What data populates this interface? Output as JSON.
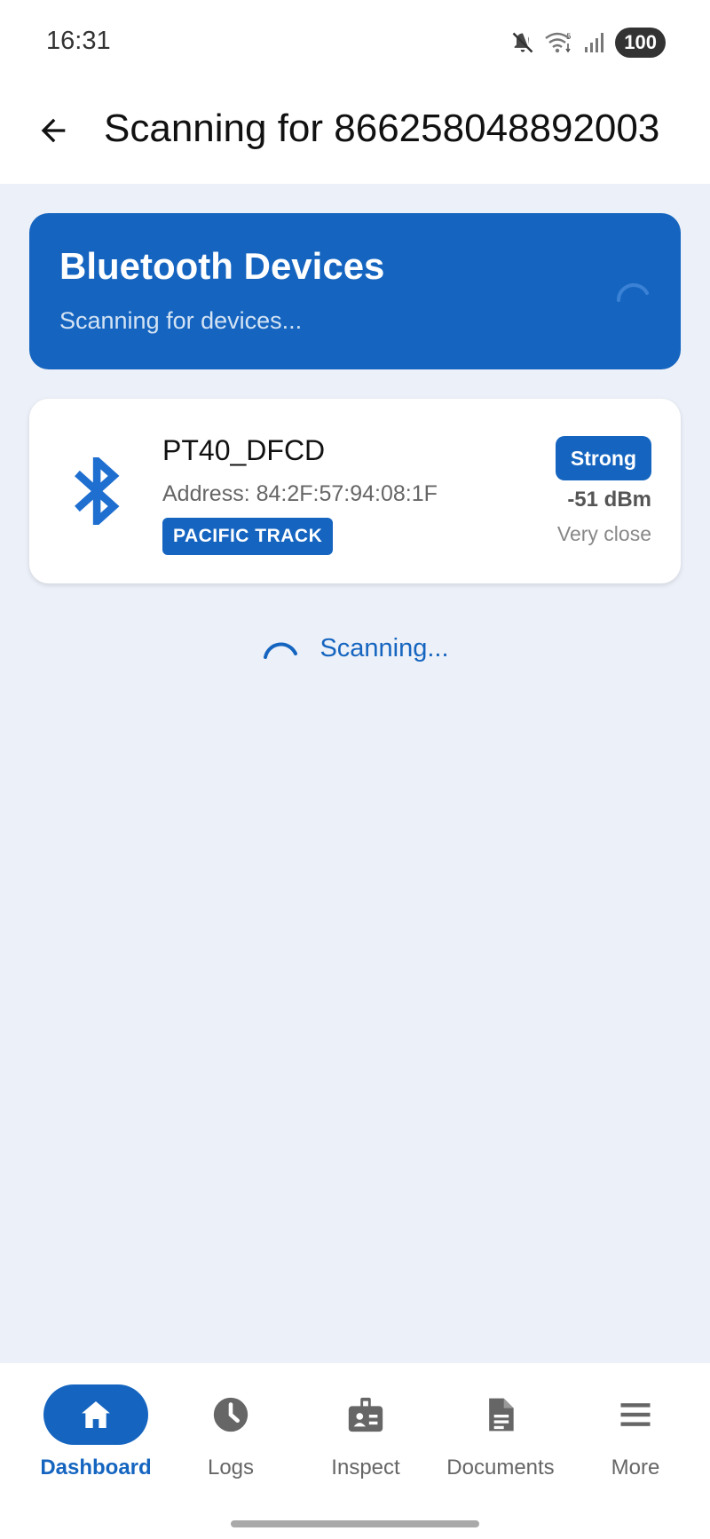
{
  "status_bar": {
    "time": "16:31",
    "battery": "100",
    "icons": [
      "mute-icon",
      "wifi-icon",
      "signal-icon"
    ]
  },
  "app_bar": {
    "title": "Scanning for 866258048892003"
  },
  "header": {
    "title": "Bluetooth Devices",
    "subtitle": "Scanning for devices..."
  },
  "devices": [
    {
      "name": "PT40_DFCD",
      "address": "Address: 84:2F:57:94:08:1F",
      "tag": "PACIFIC TRACK",
      "signal_label": "Strong",
      "rssi": "-51 dBm",
      "proximity": "Very close"
    }
  ],
  "scanning": {
    "label": "Scanning..."
  },
  "nav": {
    "items": [
      {
        "label": "Dashboard",
        "icon": "home-icon",
        "active": true
      },
      {
        "label": "Logs",
        "icon": "clock-icon",
        "active": false
      },
      {
        "label": "Inspect",
        "icon": "badge-icon",
        "active": false
      },
      {
        "label": "Documents",
        "icon": "document-icon",
        "active": false
      },
      {
        "label": "More",
        "icon": "menu-icon",
        "active": false
      }
    ]
  },
  "colors": {
    "primary": "#1565c0",
    "background": "#ecf0f8",
    "surface": "#ffffff"
  }
}
